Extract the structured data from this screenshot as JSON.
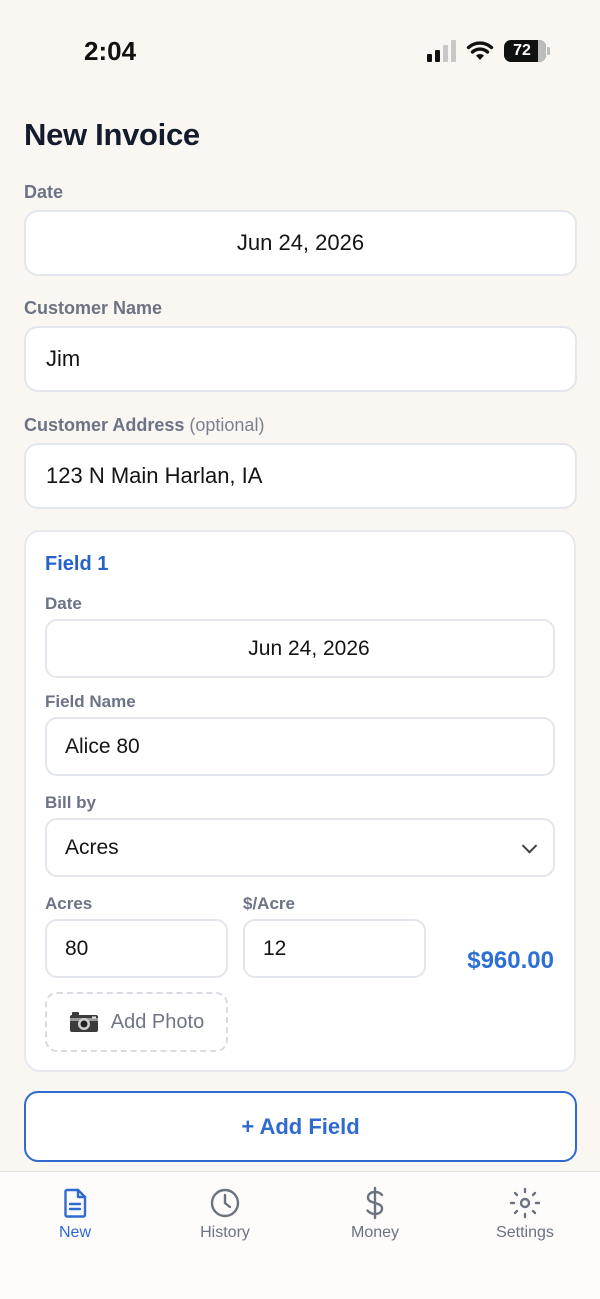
{
  "status": {
    "time": "2:04",
    "battery": "72"
  },
  "page": {
    "title": "New Invoice"
  },
  "form": {
    "date_label": "Date",
    "date_value": "Jun 24, 2026",
    "customer_name_label": "Customer Name",
    "customer_name_value": "Jim",
    "customer_address_label": "Customer Address",
    "customer_address_optional": "(optional)",
    "customer_address_value": "123 N Main Harlan, IA"
  },
  "field_card": {
    "title": "Field 1",
    "date_label": "Date",
    "date_value": "Jun 24, 2026",
    "field_name_label": "Field Name",
    "field_name_value": "Alice 80",
    "bill_by_label": "Bill by",
    "bill_by_value": "Acres",
    "acres_label": "Acres",
    "acres_value": "80",
    "rate_label": "$/Acre",
    "rate_value": "12",
    "total": "$960.00",
    "add_photo_label": "Add Photo"
  },
  "add_field_label": "+ Add Field",
  "tabs": [
    {
      "label": "New",
      "icon": "document-icon",
      "active": true
    },
    {
      "label": "History",
      "icon": "clock-icon",
      "active": false
    },
    {
      "label": "Money",
      "icon": "dollar-icon",
      "active": false
    },
    {
      "label": "Settings",
      "icon": "gear-icon",
      "active": false
    }
  ],
  "colors": {
    "accent": "#2f6ad0",
    "background": "#faf7f3",
    "label": "#6b7385"
  }
}
